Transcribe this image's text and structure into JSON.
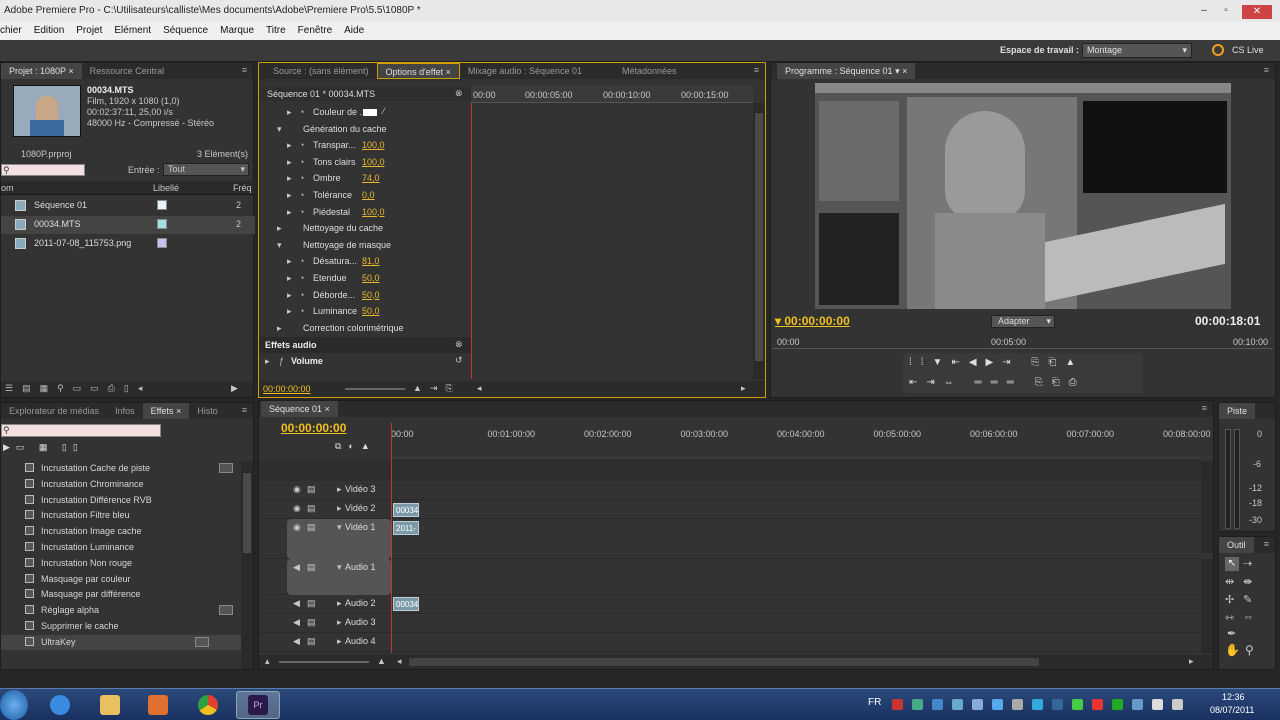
{
  "window": {
    "title": "Adobe Premiere Pro - C:\\Utilisateurs\\calliste\\Mes documents\\Adobe\\Premiere Pro\\5.5\\1080P *",
    "minimize": "–",
    "maximize": "▫",
    "close": "✕"
  },
  "menu": [
    "chier",
    "Edition",
    "Projet",
    "Elément",
    "Séquence",
    "Marque",
    "Titre",
    "Fenêtre",
    "Aide"
  ],
  "workspace": {
    "label": "Espace de travail :",
    "value": "Montage",
    "cslive": "CS Live"
  },
  "project": {
    "tabs": [
      "Projet : 1080P",
      "Ressource Central"
    ],
    "clip_name": "00034.MTS",
    "clip_info1": "Film, 1920 x 1080 (1,0)",
    "clip_info2": "00:02:37:11, 25,00 i/s",
    "clip_info3": "48000 Hz - Compressé - Stéréo",
    "file": "1080P.prproj",
    "count": "3 Elément(s)",
    "entry_label": "Entrée :",
    "entry_value": "Tout",
    "col_name": "om",
    "col_label": "Libellé",
    "col_freq": "Fréq",
    "items": [
      {
        "name": "Séquence 01",
        "val": "2",
        "color": "#e8f4f8"
      },
      {
        "name": "00034.MTS",
        "val": "2",
        "color": "#a0e0e0"
      },
      {
        "name": "2011-07-08_115753.png",
        "val": "",
        "color": "#c8c0f0"
      }
    ]
  },
  "effects_ctrl": {
    "tabs": [
      "Source : (sans élément)",
      "Options d'effet",
      "Mixage audio : Séquence 01",
      "Métadonnées"
    ],
    "header": "Séquence 01 * 00034.MTS",
    "ruler": [
      "00:00",
      "00:00:05:00",
      "00:00:10:00",
      "00:00:15:00"
    ],
    "rows": [
      {
        "indent": 2,
        "label": "Couleur de ...",
        "value": ""
      },
      {
        "indent": 1,
        "label": "Génération du cache",
        "value": ""
      },
      {
        "indent": 2,
        "label": "Transpar...",
        "value": "100,0"
      },
      {
        "indent": 2,
        "label": "Tons clairs",
        "value": "100,0"
      },
      {
        "indent": 2,
        "label": "Ombre",
        "value": "74,0"
      },
      {
        "indent": 2,
        "label": "Tolérance",
        "value": "0,0"
      },
      {
        "indent": 2,
        "label": "Piédestal",
        "value": "100,0"
      },
      {
        "indent": 1,
        "label": "Nettoyage du cache",
        "value": ""
      },
      {
        "indent": 1,
        "label": "Nettoyage de masque",
        "value": ""
      },
      {
        "indent": 2,
        "label": "Désatura...",
        "value": "81,0"
      },
      {
        "indent": 2,
        "label": "Etendue",
        "value": "50,0"
      },
      {
        "indent": 2,
        "label": "Déborde...",
        "value": "50,0"
      },
      {
        "indent": 2,
        "label": "Luminance",
        "value": "50,0"
      },
      {
        "indent": 1,
        "label": "Correction colorimétrique",
        "value": ""
      }
    ],
    "audio_effects": "Effets audio",
    "volume": "Volume",
    "timecode": "00:00:00:00"
  },
  "program": {
    "tab": "Programme : Séquence 01",
    "timecode": "00:00:00:00",
    "fit": "Adapter",
    "duration": "00:00:18:01",
    "ruler": [
      "00:00",
      "00:05:00",
      "00:10:00"
    ]
  },
  "effects_panel": {
    "tabs": [
      "Explorateur de médias",
      "Infos",
      "Effets",
      "Histo"
    ],
    "items": [
      "Incrustation Cache de piste",
      "Incrustation Chrominance",
      "Incrustation Différence RVB",
      "Incrustation Filtre bleu",
      "Incrustation Image cache",
      "Incrustation Luminance",
      "Incrustation Non rouge",
      "Masquage par couleur",
      "Masquage par différence",
      "Réglage alpha",
      "Supprimer le cache",
      "UltraKey"
    ]
  },
  "timeline": {
    "tab": "Séquence 01",
    "timecode": "00:00:00:00",
    "ruler": [
      "00:00",
      "00:01:00:00",
      "00:02:00:00",
      "00:03:00:00",
      "00:04:00:00",
      "00:05:00:00",
      "00:06:00:00",
      "00:07:00:00",
      "00:08:00:00"
    ],
    "tracks": [
      "Vidéo 3",
      "Vidéo 2",
      "Vidéo 1",
      "Audio 1",
      "Audio 2",
      "Audio 3",
      "Audio 4"
    ],
    "clip_v2": "00034",
    "clip_v1": "2011-",
    "clip_a2": "00034"
  },
  "meters": {
    "tab": "Piste",
    "labels": [
      "0",
      "-6",
      "-12",
      "-18",
      "-30"
    ]
  },
  "tools": {
    "tab": "Outil"
  },
  "taskbar": {
    "lang": "FR",
    "time": "12:36",
    "date": "08/07/2011"
  }
}
